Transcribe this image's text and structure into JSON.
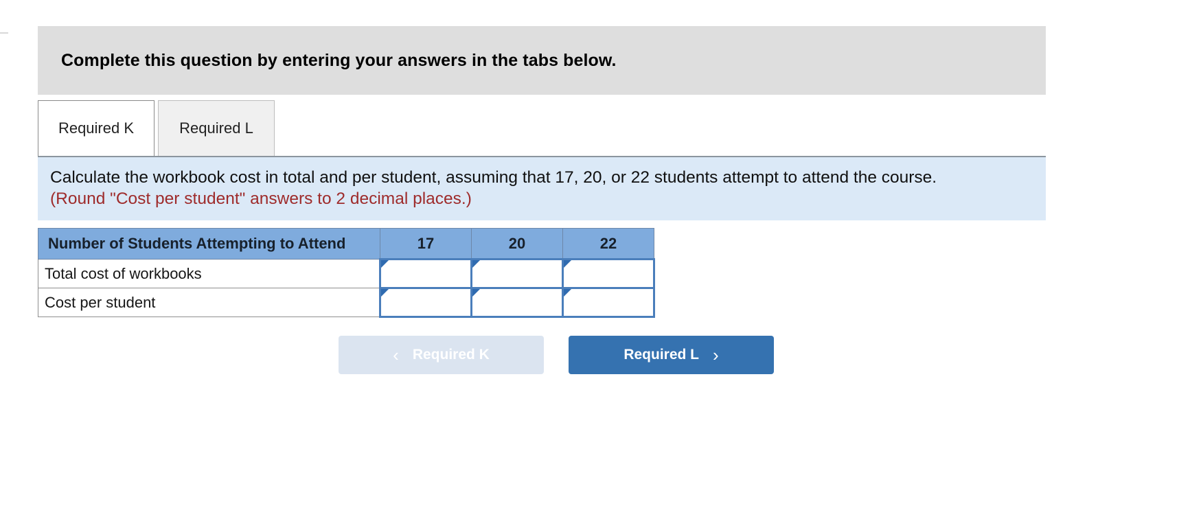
{
  "banner": {
    "text": "Complete this question by entering your answers in the tabs below."
  },
  "tabs": [
    {
      "label": "Required K",
      "state": "active"
    },
    {
      "label": "Required L",
      "state": "inactive"
    }
  ],
  "instructions": {
    "line1": "Calculate the workbook cost in total and per student, assuming that 17, 20, or 22 students attempt to attend the course.",
    "line2": "(Round \"Cost per student\" answers to 2 decimal places.)"
  },
  "table": {
    "headers": [
      "Number of Students Attempting to Attend",
      "17",
      "20",
      "22"
    ],
    "rows": [
      {
        "label": "Total cost of workbooks",
        "values": [
          "",
          "",
          ""
        ],
        "placeholders": [
          "",
          "",
          ""
        ]
      },
      {
        "label": "Cost per student",
        "values": [
          "",
          "",
          ""
        ],
        "placeholders": [
          "",
          "",
          ""
        ]
      }
    ]
  },
  "navigation": {
    "prev": {
      "label": "Required K",
      "icon": "chevron-left-icon",
      "glyph": "‹",
      "disabled": true
    },
    "next": {
      "label": "Required L",
      "icon": "chevron-right-icon",
      "glyph": "›",
      "disabled": false
    }
  },
  "colors": {
    "banner_bg": "#dedede",
    "instruction_bg": "#dbe9f7",
    "note_text": "#9e2b2b",
    "table_header_bg": "#7fabdd",
    "input_border": "#4a7ebb",
    "flag": "#2f6bb0",
    "btn_next_bg": "#3572b0",
    "btn_prev_bg": "#dbe4f0"
  }
}
